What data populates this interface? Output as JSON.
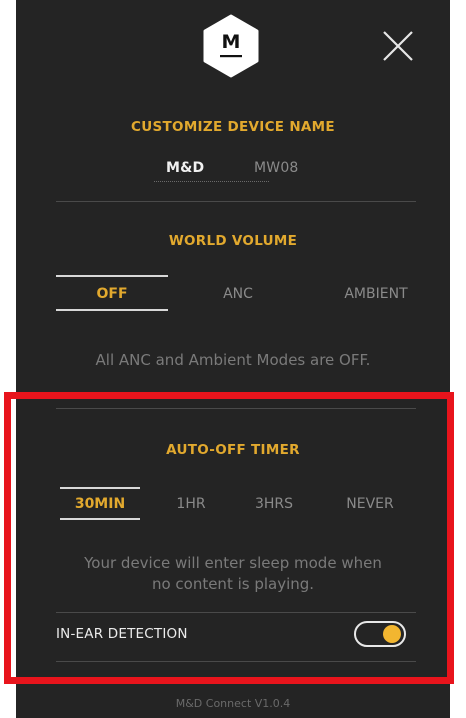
{
  "logo": {
    "text": "M"
  },
  "device_name": {
    "title": "CUSTOMIZE DEVICE NAME",
    "name": "M&D",
    "model": "MW08"
  },
  "world_volume": {
    "title": "WORLD VOLUME",
    "options": [
      "OFF",
      "ANC",
      "AMBIENT"
    ],
    "selected": "OFF",
    "note": "All ANC and Ambient Modes are OFF."
  },
  "auto_off": {
    "title": "AUTO-OFF TIMER",
    "options": [
      "30MIN",
      "1HR",
      "3HRS",
      "NEVER"
    ],
    "selected": "30MIN",
    "note_line1": "Your device will enter sleep mode when",
    "note_line2": "no content is playing."
  },
  "in_ear": {
    "label": "IN-EAR DETECTION",
    "enabled": true
  },
  "footer": {
    "version": "M&D Connect V1.0.4"
  },
  "colors": {
    "background": "#242424",
    "accent": "#e2a92e",
    "toggle_knob": "#f2b630",
    "highlight": "#e8141c"
  }
}
